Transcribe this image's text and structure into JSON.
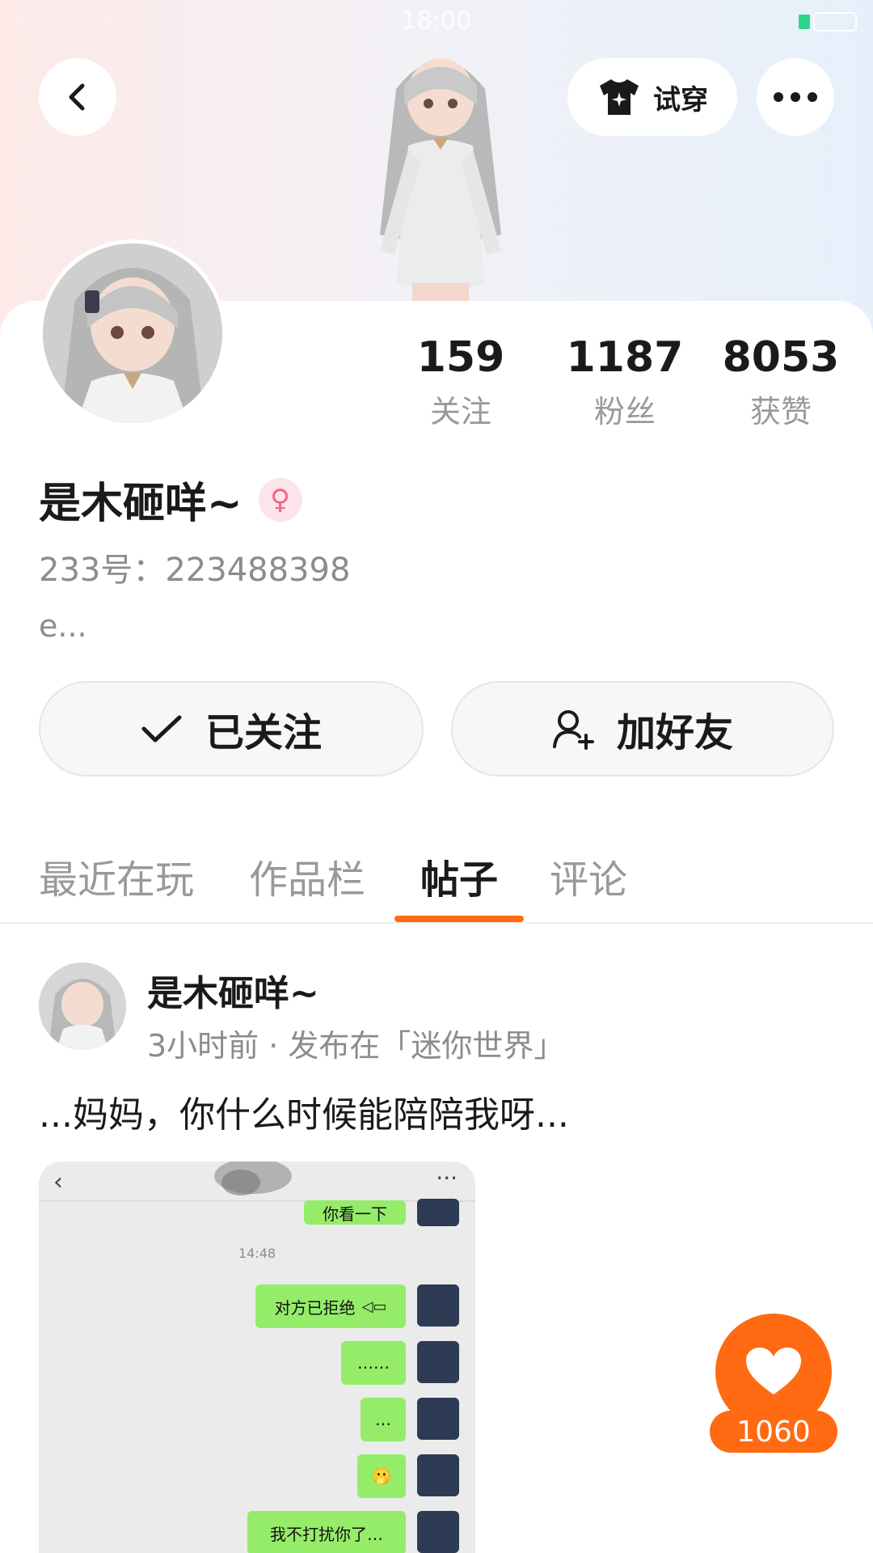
{
  "status_bar": {
    "time": "18:00"
  },
  "header": {
    "try_on_label": "试穿"
  },
  "profile": {
    "name": "是木砸咩~",
    "gender_icon": "female",
    "uid": "233号：223488398",
    "bio": "e..."
  },
  "stats": [
    {
      "value": "159",
      "label": "关注"
    },
    {
      "value": "1187",
      "label": "粉丝"
    },
    {
      "value": "8053",
      "label": "获赞"
    }
  ],
  "actions": {
    "followed_label": "已关注",
    "add_friend_label": "加好友"
  },
  "tabs": [
    "最近在玩",
    "作品栏",
    "帖子",
    "评论"
  ],
  "active_tab": "帖子",
  "post": {
    "author": "是木砸咩~",
    "meta": "3小时前 · 发布在「迷你世界」",
    "text": "...妈妈，你什么时候能陪陪我呀...",
    "image": {
      "time": "14:48",
      "messages": [
        "你看一下",
        "对方已拒绝",
        "……",
        "…",
        "🫢",
        "我不打扰你了…"
      ]
    }
  },
  "like": {
    "count": "1060"
  },
  "colors": {
    "accent": "#ff6a12",
    "bubble": "#95ec69",
    "female": "#f0668a"
  }
}
